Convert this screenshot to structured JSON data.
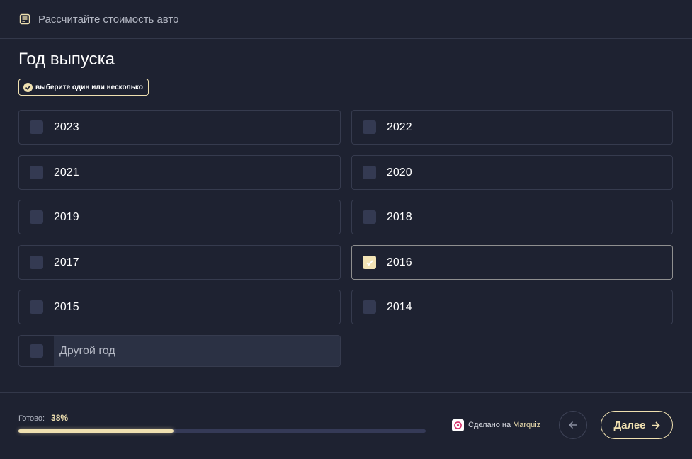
{
  "header": {
    "icon": "list-checklist-icon",
    "title": "Рассчитайте стоимость авто"
  },
  "question": {
    "title": "Год выпуска",
    "hint": "выберите один или несколько",
    "hint_icon": "check-circle-icon"
  },
  "options": [
    {
      "label": "2023",
      "selected": false
    },
    {
      "label": "2022",
      "selected": false
    },
    {
      "label": "2021",
      "selected": false
    },
    {
      "label": "2020",
      "selected": false
    },
    {
      "label": "2019",
      "selected": false
    },
    {
      "label": "2018",
      "selected": false
    },
    {
      "label": "2017",
      "selected": false
    },
    {
      "label": "2016",
      "selected": true
    },
    {
      "label": "2015",
      "selected": false
    },
    {
      "label": "2014",
      "selected": false
    }
  ],
  "other": {
    "placeholder": "Другой год",
    "value": ""
  },
  "footer": {
    "progress_label": "Готово:",
    "progress_text": "38%",
    "progress_value": 0.38,
    "made_with": "Сделано на",
    "brand": "Marquiz",
    "brand_icon": "marquiz-logo-icon",
    "back_icon": "arrow-left-icon",
    "next_label": "Далее",
    "next_icon": "arrow-right-icon"
  },
  "colors": {
    "background": "#1e2231",
    "accent": "#efe0b0",
    "checkbox": "#343a52",
    "border": "#363b4e"
  }
}
